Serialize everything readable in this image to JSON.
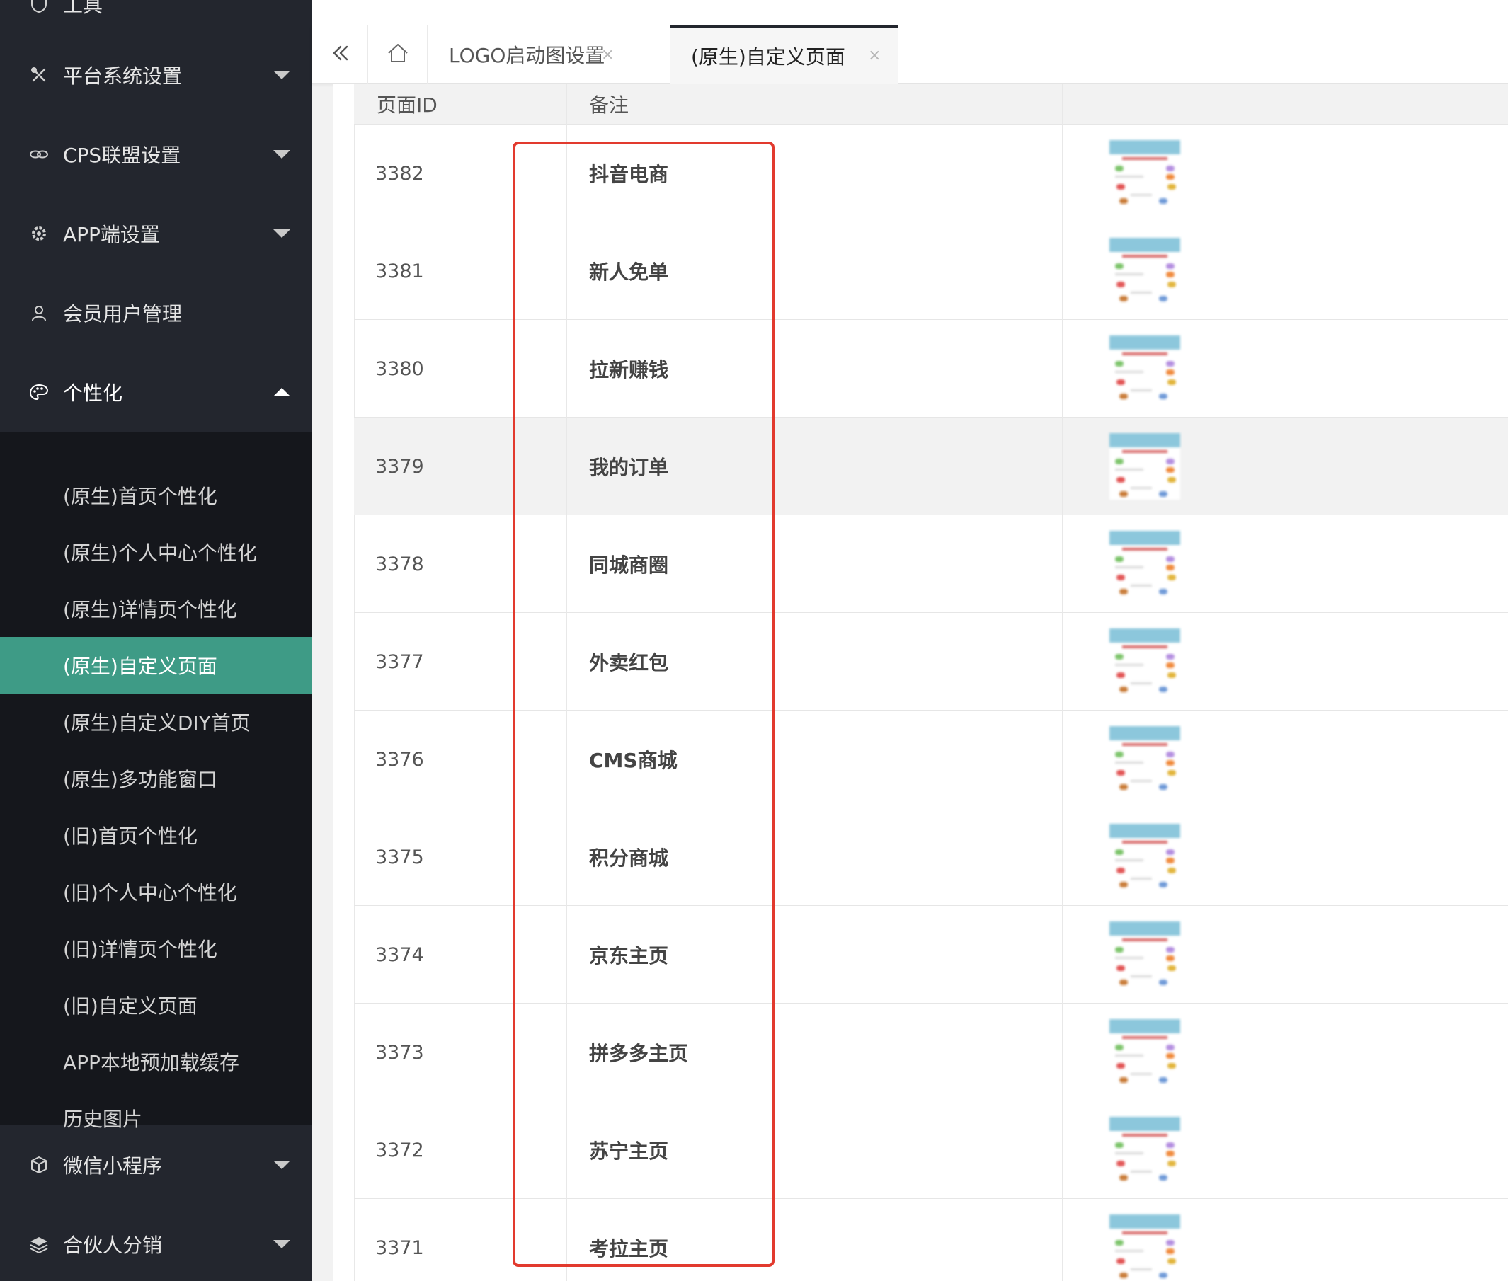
{
  "sidebar": {
    "top_item": {
      "label": "工具",
      "icon": "shield-icon"
    },
    "items": [
      {
        "label": "平台系统设置",
        "icon": "tools-icon",
        "state": "collapsed"
      },
      {
        "label": "CPS联盟设置",
        "icon": "link-icon",
        "state": "collapsed"
      },
      {
        "label": "APP端设置",
        "icon": "gear-icon",
        "state": "collapsed"
      },
      {
        "label": "会员用户管理",
        "icon": "user-icon",
        "state": "none"
      },
      {
        "label": "个性化",
        "icon": "palette-icon",
        "state": "expanded"
      },
      {
        "label": "微信小程序",
        "icon": "cube-icon",
        "state": "collapsed"
      },
      {
        "label": "合伙人分销",
        "icon": "layers-icon",
        "state": "collapsed"
      }
    ],
    "submenu": [
      "(原生)首页个性化",
      "(原生)个人中心个性化",
      "(原生)详情页个性化",
      "(原生)自定义页面",
      "(原生)自定义DIY首页",
      "(原生)多功能窗口",
      "(旧)首页个性化",
      "(旧)个人中心个性化",
      "(旧)详情页个性化",
      "(旧)自定义页面",
      "APP本地预加载缓存",
      "历史图片"
    ],
    "active_submenu": "(原生)自定义页面",
    "active_color": "#3e9b86"
  },
  "tabs": {
    "collapse_icon": "double-chevron-left-icon",
    "home_icon": "home-icon",
    "items": [
      {
        "label": "LOGO启动图设置",
        "close": "×",
        "active": false
      },
      {
        "label": "(原生)自定义页面",
        "close": "×",
        "active": true
      }
    ]
  },
  "table": {
    "headers": [
      "页面ID",
      "备注",
      "",
      ""
    ],
    "highlighted_row": "3379",
    "rows": [
      {
        "id": "3382",
        "note": "抖音电商"
      },
      {
        "id": "3381",
        "note": "新人免单"
      },
      {
        "id": "3380",
        "note": "拉新赚钱"
      },
      {
        "id": "3379",
        "note": "我的订单"
      },
      {
        "id": "3378",
        "note": "同城商圈"
      },
      {
        "id": "3377",
        "note": "外卖红包"
      },
      {
        "id": "3376",
        "note": "CMS商城"
      },
      {
        "id": "3375",
        "note": "积分商城"
      },
      {
        "id": "3374",
        "note": "京东主页"
      },
      {
        "id": "3373",
        "note": "拼多多主页"
      },
      {
        "id": "3372",
        "note": "苏宁主页"
      },
      {
        "id": "3371",
        "note": "考拉主页"
      }
    ]
  },
  "annotation": {
    "color": "#e23a2e"
  }
}
